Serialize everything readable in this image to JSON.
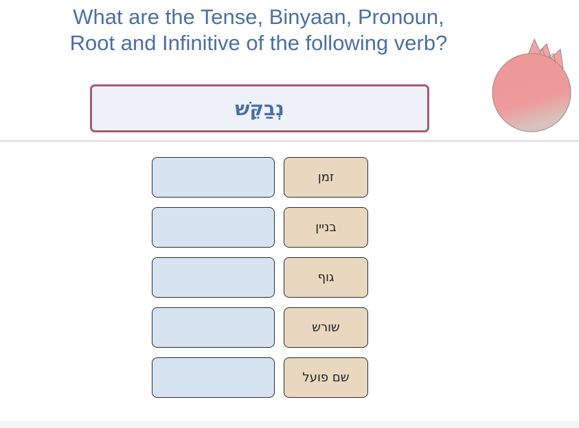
{
  "question": {
    "line1": "What are the Tense, Binyaan, Pronoun,",
    "line2": "Root and Infinitive of the following verb?"
  },
  "verb": "נְבַקֵּשׁ",
  "rows": [
    {
      "label": "זמן",
      "answer": ""
    },
    {
      "label": "בניין",
      "answer": ""
    },
    {
      "label": "גוף",
      "answer": ""
    },
    {
      "label": "שורש",
      "answer": ""
    },
    {
      "label": "שם פועל",
      "answer": ""
    }
  ],
  "colors": {
    "title": "#4a6fa5",
    "verb_border": "#a45a6e",
    "answer_bg": "#d6e4f2",
    "label_bg": "#e8d8c0",
    "pomegranate": "#ef9a9a"
  },
  "icons": {
    "decoration": "pomegranate-icon"
  }
}
